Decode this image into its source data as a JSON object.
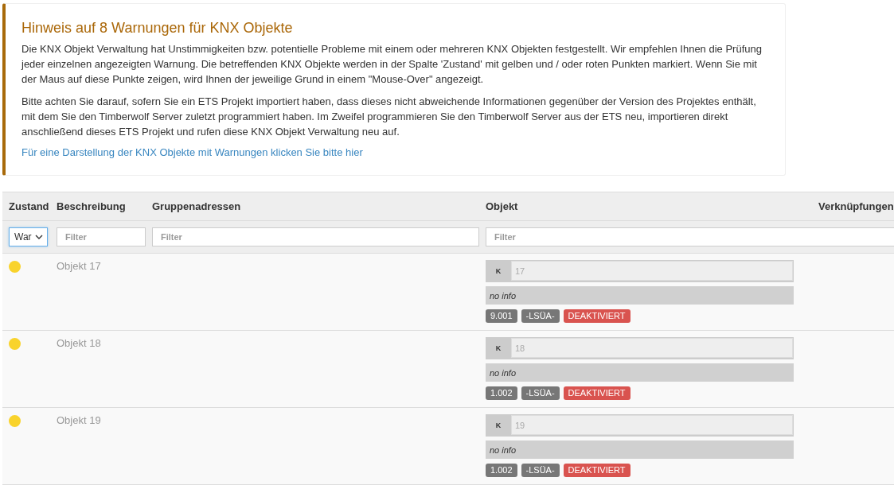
{
  "notice": {
    "title": "Hinweis auf 8 Warnungen für KNX Objekte",
    "paragraphs": [
      "Die KNX Objekt Verwaltung hat Unstimmigkeiten bzw. potentielle Probleme mit einem oder mehreren KNX Objekten festgestellt. Wir empfehlen Ihnen die Prüfung jeder einzelnen angezeigten Warnung. Die betreffenden KNX Objekte werden in der Spalte 'Zustand' mit gelben und / oder roten Punkten markiert. Wenn Sie mit der Maus auf diese Punkte zeigen, wird Ihnen der jeweilige Grund in einem \"Mouse-Over\" angezeigt.",
      "Bitte achten Sie darauf, sofern Sie ein ETS Projekt importiert haben, dass dieses nicht abweichende Informationen gegenüber der Version des Projektes enthält, mit dem Sie den Timberwolf Server zuletzt programmiert haben. Im Zweifel programmieren Sie den Timberwolf Server aus der ETS neu, importieren direkt anschließend dieses ETS Projekt und rufen diese KNX Objekt Verwaltung neu auf."
    ],
    "link": "Für eine Darstellung der KNX Objekte mit Warnungen klicken Sie bitte hier"
  },
  "table": {
    "columns": [
      "Zustand",
      "Beschreibung",
      "Gruppenadressen",
      "Objekt",
      "Verknüpfungen"
    ],
    "filters": [
      {
        "kind": "select",
        "value": "War"
      },
      {
        "kind": "text",
        "placeholder": "Filter"
      },
      {
        "kind": "text",
        "placeholder": "Filter"
      },
      {
        "kind": "text",
        "placeholder": "Filter"
      }
    ],
    "rows": [
      {
        "color": "#f9d32c",
        "description": "Objekt 17",
        "prefix": "K",
        "number": "17",
        "info": "no info",
        "badges": [
          {
            "text": "9.001",
            "kind": "grey"
          },
          {
            "text": "-LSÜA-",
            "kind": "grey"
          },
          {
            "text": "DEAKTIVIERT",
            "kind": "red"
          }
        ]
      },
      {
        "color": "#f9d32c",
        "description": "Objekt 18",
        "prefix": "K",
        "number": "18",
        "info": "no info",
        "badges": [
          {
            "text": "1.002",
            "kind": "grey"
          },
          {
            "text": "-LSÜA-",
            "kind": "grey"
          },
          {
            "text": "DEAKTIVIERT",
            "kind": "red"
          }
        ]
      },
      {
        "color": "#f9d32c",
        "description": "Objekt 19",
        "prefix": "K",
        "number": "19",
        "info": "no info",
        "badges": [
          {
            "text": "1.002",
            "kind": "grey"
          },
          {
            "text": "-LSÜA-",
            "kind": "grey"
          },
          {
            "text": "DEAKTIVIERT",
            "kind": "red"
          }
        ]
      }
    ]
  }
}
